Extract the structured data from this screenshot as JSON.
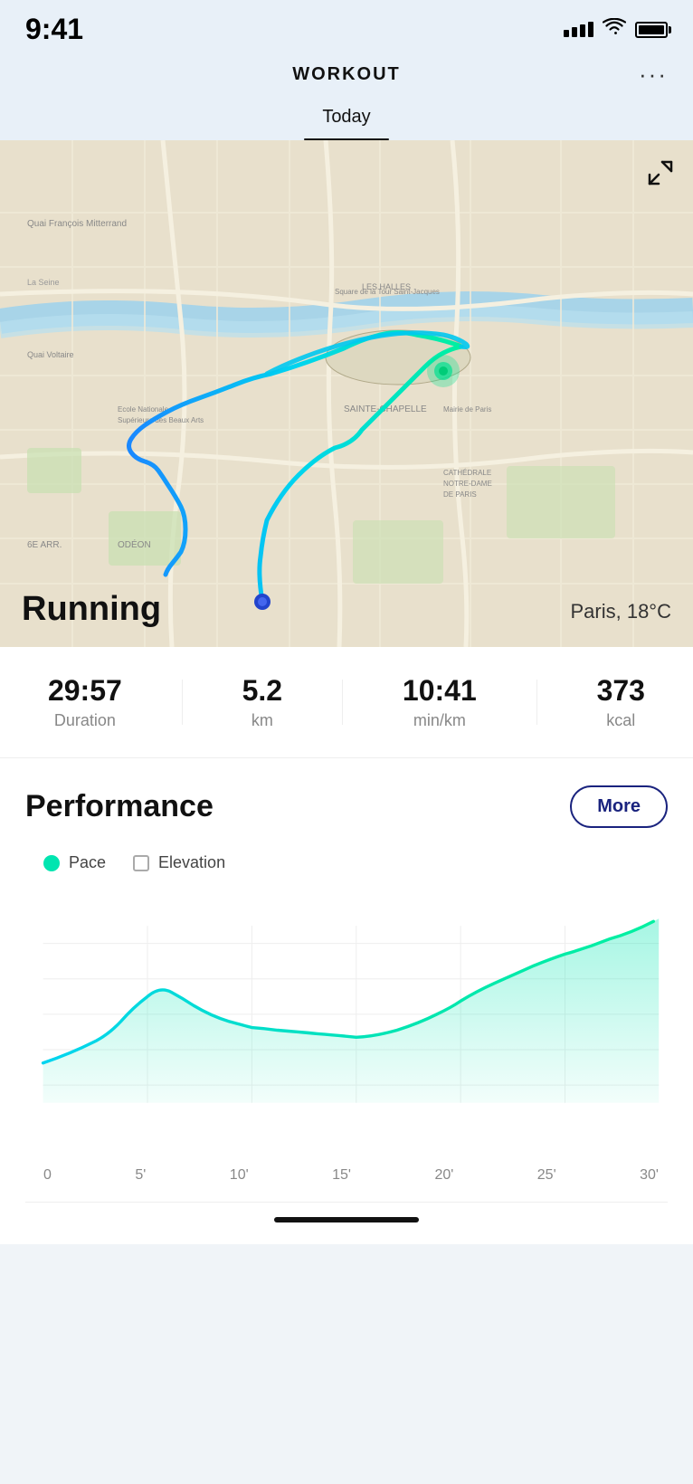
{
  "statusBar": {
    "time": "9:41",
    "signalBars": [
      4,
      8,
      12,
      16
    ],
    "battery": 100
  },
  "header": {
    "title": "WORKOUT",
    "moreLabel": "···"
  },
  "tabs": [
    {
      "label": "Today",
      "active": true
    }
  ],
  "map": {
    "expandIcon": "↗",
    "activityType": "Running",
    "location": "Paris, 18°C"
  },
  "stats": [
    {
      "value": "29:57",
      "label": "Duration"
    },
    {
      "value": "5.2",
      "label": "km"
    },
    {
      "value": "10:41",
      "label": "min/km"
    },
    {
      "value": "373",
      "label": "kcal"
    }
  ],
  "performance": {
    "title": "Performance",
    "moreButton": "More",
    "legend": [
      {
        "type": "dot",
        "label": "Pace"
      },
      {
        "type": "square",
        "label": "Elevation"
      }
    ],
    "chart": {
      "xLabels": [
        "0",
        "5'",
        "10'",
        "15'",
        "20'",
        "25'",
        "30'"
      ],
      "gridLines": 4
    }
  },
  "homeIndicator": ""
}
